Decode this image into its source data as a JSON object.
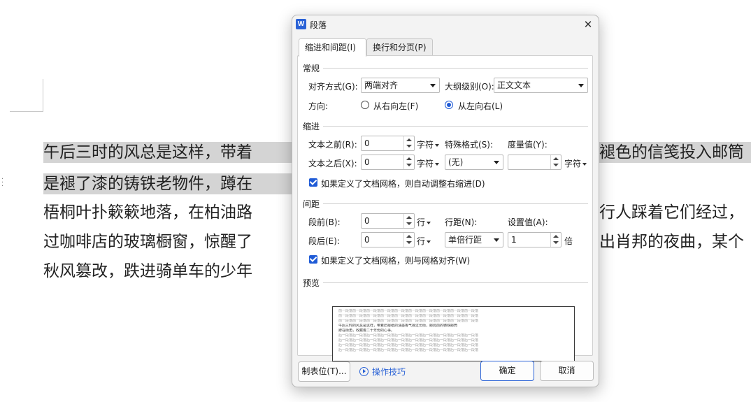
{
  "document": {
    "lines": [
      {
        "left": "午后三时的风总是这样，带着",
        "right": "褪色的信笺投入邮筒",
        "selected": true
      },
      {
        "left": "是褪了漆的铸铁老物件，蹲在",
        "right": "",
        "selected": true
      },
      {
        "left": "梧桐叶扑簌簌地落，在柏油路",
        "right": "行人踩着它们经过，",
        "selected": false
      },
      {
        "left": "过咖啡店的玻璃橱窗，惊醒了",
        "right": "出肖邦的夜曲，某个",
        "selected": false
      },
      {
        "left": "秋风篡改，跌进骑单车的少年",
        "right": "",
        "selected": false
      }
    ]
  },
  "dialog": {
    "app_icon_letter": "W",
    "title": "段落",
    "close_glyph": "✕",
    "tabs": [
      {
        "label": "缩进和间距(I)",
        "active": true
      },
      {
        "label": "换行和分页(P)",
        "active": false
      }
    ],
    "general": {
      "title": "常规",
      "alignment_label": "对齐方式(G):",
      "alignment_value": "两端对齐",
      "outline_label": "大纲级别(O):",
      "outline_value": "正文文本",
      "direction_label": "方向:",
      "rtl_label": "从右向左(F)",
      "ltr_label": "从左向右(L)",
      "direction_selected": "ltr"
    },
    "indent": {
      "title": "缩进",
      "before_label": "文本之前(R):",
      "before_value": "0",
      "before_unit": "字符",
      "after_label": "文本之后(X):",
      "after_value": "0",
      "after_unit": "字符",
      "special_label": "特殊格式(S):",
      "special_value": "(无)",
      "measure_label": "度量值(Y):",
      "measure_value": "",
      "measure_unit": "字符",
      "auto_adjust_label": "如果定义了文档网格，则自动调整右缩进(D)",
      "auto_adjust_checked": true
    },
    "spacing": {
      "title": "间距",
      "before_label": "段前(B):",
      "before_value": "0",
      "before_unit": "行",
      "after_label": "段后(E):",
      "after_value": "0",
      "after_unit": "行",
      "line_label": "行距(N):",
      "line_value": "单倍行距",
      "setting_label": "设置值(A):",
      "setting_value": "1",
      "setting_unit": "倍",
      "snap_grid_label": "如果定义了文档网格，则与网格对齐(W)",
      "snap_grid_checked": true
    },
    "preview": {
      "title": "预览",
      "prev_line": "前一段落前一段落前一段落前一段落前一段落前一段落前一段落前一段落前一段落前一段落",
      "sample_line_1": "午后三时的风总是这样，带着旧报纸的油墨香气掠过长街，邮局前的铸铁邮筒",
      "sample_line_2": "蹲在街角，收藏着二十年份的心事。",
      "next_line": "后一段落后一段落后一段落后一段落后一段落后一段落后一段落后一段落后一段落后一段落"
    },
    "buttons": {
      "tabs_label": "制表位(T)...",
      "tips_label": "操作技巧",
      "ok_label": "确定",
      "cancel_label": "取消"
    }
  },
  "colors": {
    "accent": "#1f5bd6",
    "selection": "#d4d4d4"
  }
}
